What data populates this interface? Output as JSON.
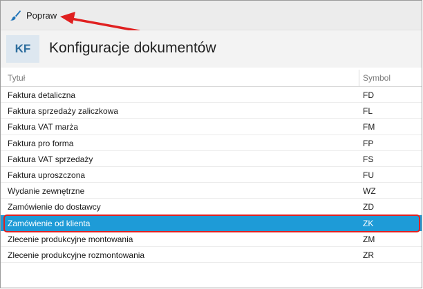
{
  "toolbar": {
    "edit_label": "Popraw",
    "edit_icon": "brush-icon"
  },
  "header": {
    "badge": "KF",
    "title": "Konfiguracje dokumentów"
  },
  "table": {
    "columns": [
      "Tytuł",
      "Symbol"
    ],
    "rows": [
      {
        "title": "Faktura detaliczna",
        "symbol": "FD"
      },
      {
        "title": "Faktura sprzedaży zaliczkowa",
        "symbol": "FL"
      },
      {
        "title": "Faktura VAT marża",
        "symbol": "FM"
      },
      {
        "title": "Faktura pro forma",
        "symbol": "FP"
      },
      {
        "title": "Faktura VAT sprzedaży",
        "symbol": "FS"
      },
      {
        "title": "Faktura uproszczona",
        "symbol": "FU"
      },
      {
        "title": "Wydanie zewnętrzne",
        "symbol": "WZ"
      },
      {
        "title": "Zamówienie do dostawcy",
        "symbol": "ZD"
      },
      {
        "title": "Zamówienie od klienta",
        "symbol": "ZK",
        "selected": true
      },
      {
        "title": "Zlecenie produkcyjne montowania",
        "symbol": "ZM"
      },
      {
        "title": "Zlecenie produkcyjne rozmontowania",
        "symbol": "ZR"
      }
    ]
  },
  "colors": {
    "selection": "#1e9bd7",
    "annotation": "#e02020",
    "badge_text": "#2e6e9e"
  }
}
